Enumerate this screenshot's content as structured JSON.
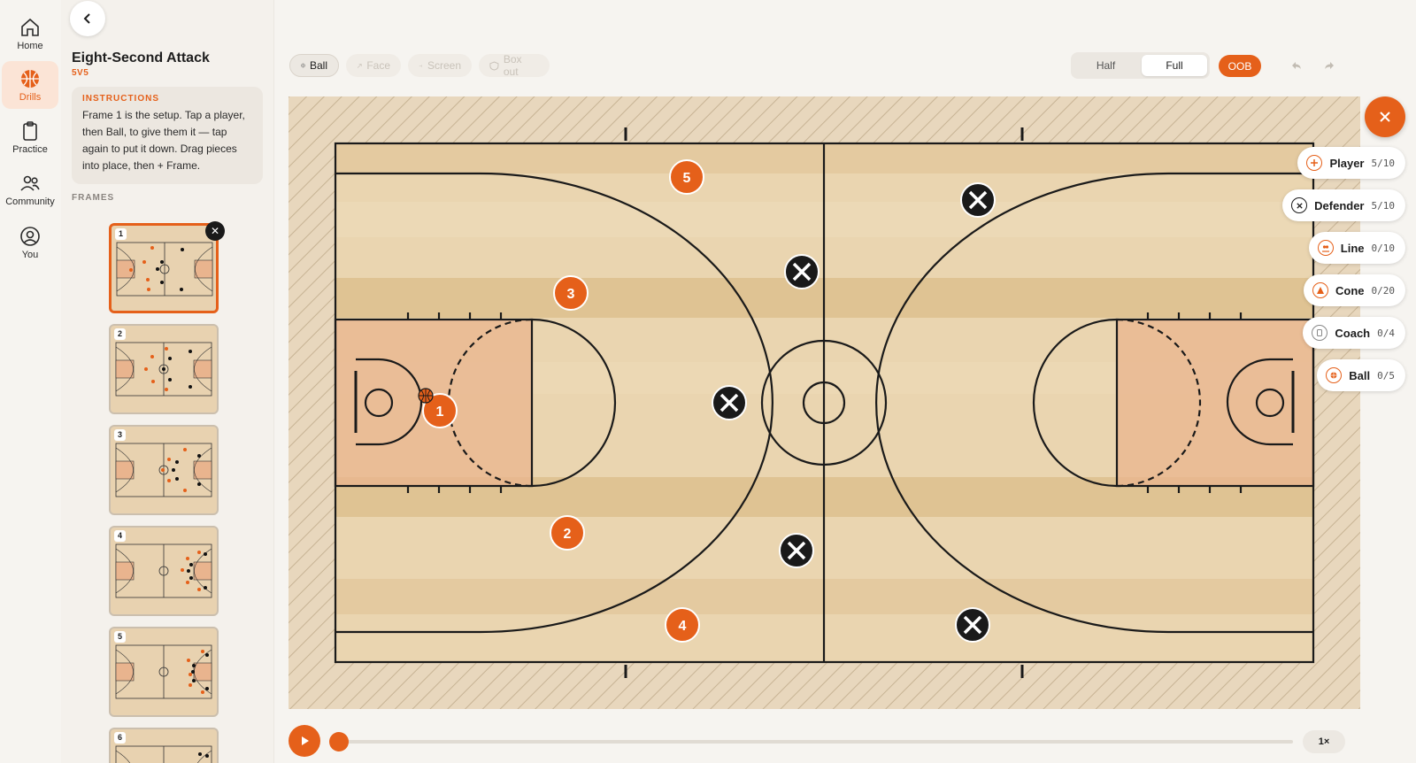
{
  "nav": {
    "items": [
      {
        "label": "Home",
        "icon": "home-icon"
      },
      {
        "label": "Drills",
        "icon": "basketball-icon"
      },
      {
        "label": "Practice",
        "icon": "clipboard-icon"
      },
      {
        "label": "Community",
        "icon": "people-icon"
      },
      {
        "label": "You",
        "icon": "user-icon"
      }
    ],
    "active": "Drills"
  },
  "drill": {
    "title": "Eight-Second Attack",
    "format": "5V5",
    "instructions_label": "INSTRUCTIONS",
    "instructions": "Frame 1 is the setup. Tap a player, then Ball, to give them it — tap again to put it down. Drag pieces into place, then + Frame.",
    "frames_label": "FRAMES",
    "frames": [
      "1",
      "2",
      "3",
      "4",
      "5",
      "6"
    ],
    "selected_frame": "1"
  },
  "toolbar": {
    "tools": [
      {
        "label": "Ball",
        "state": "active"
      },
      {
        "label": "Face",
        "state": "disabled"
      },
      {
        "label": "Screen",
        "state": "disabled"
      },
      {
        "label": "Box out",
        "state": "disabled"
      }
    ],
    "view": {
      "half": "Half",
      "full": "Full",
      "selected": "Full"
    },
    "oob": "OOB"
  },
  "palette": [
    {
      "label": "Player",
      "count": "5/10",
      "icon": "player-add-icon"
    },
    {
      "label": "Defender",
      "count": "5/10",
      "icon": "defender-x-icon"
    },
    {
      "label": "Line",
      "count": "0/10",
      "icon": "line-icon"
    },
    {
      "label": "Cone",
      "count": "0/20",
      "icon": "cone-icon"
    },
    {
      "label": "Coach",
      "count": "0/4",
      "icon": "coach-icon"
    },
    {
      "label": "Ball",
      "count": "0/5",
      "icon": "ball-icon"
    }
  ],
  "court": {
    "players": [
      "1",
      "2",
      "3",
      "4",
      "5"
    ],
    "ball_holder": "1",
    "defenders": 5
  },
  "playback": {
    "speed": "1×",
    "progress": 0
  },
  "colors": {
    "accent": "#e5601a",
    "wood_light": "#e9d3ad",
    "wood_dark": "#ddc093",
    "paint": "#e9b48e",
    "defender": "#1a1a1a"
  }
}
